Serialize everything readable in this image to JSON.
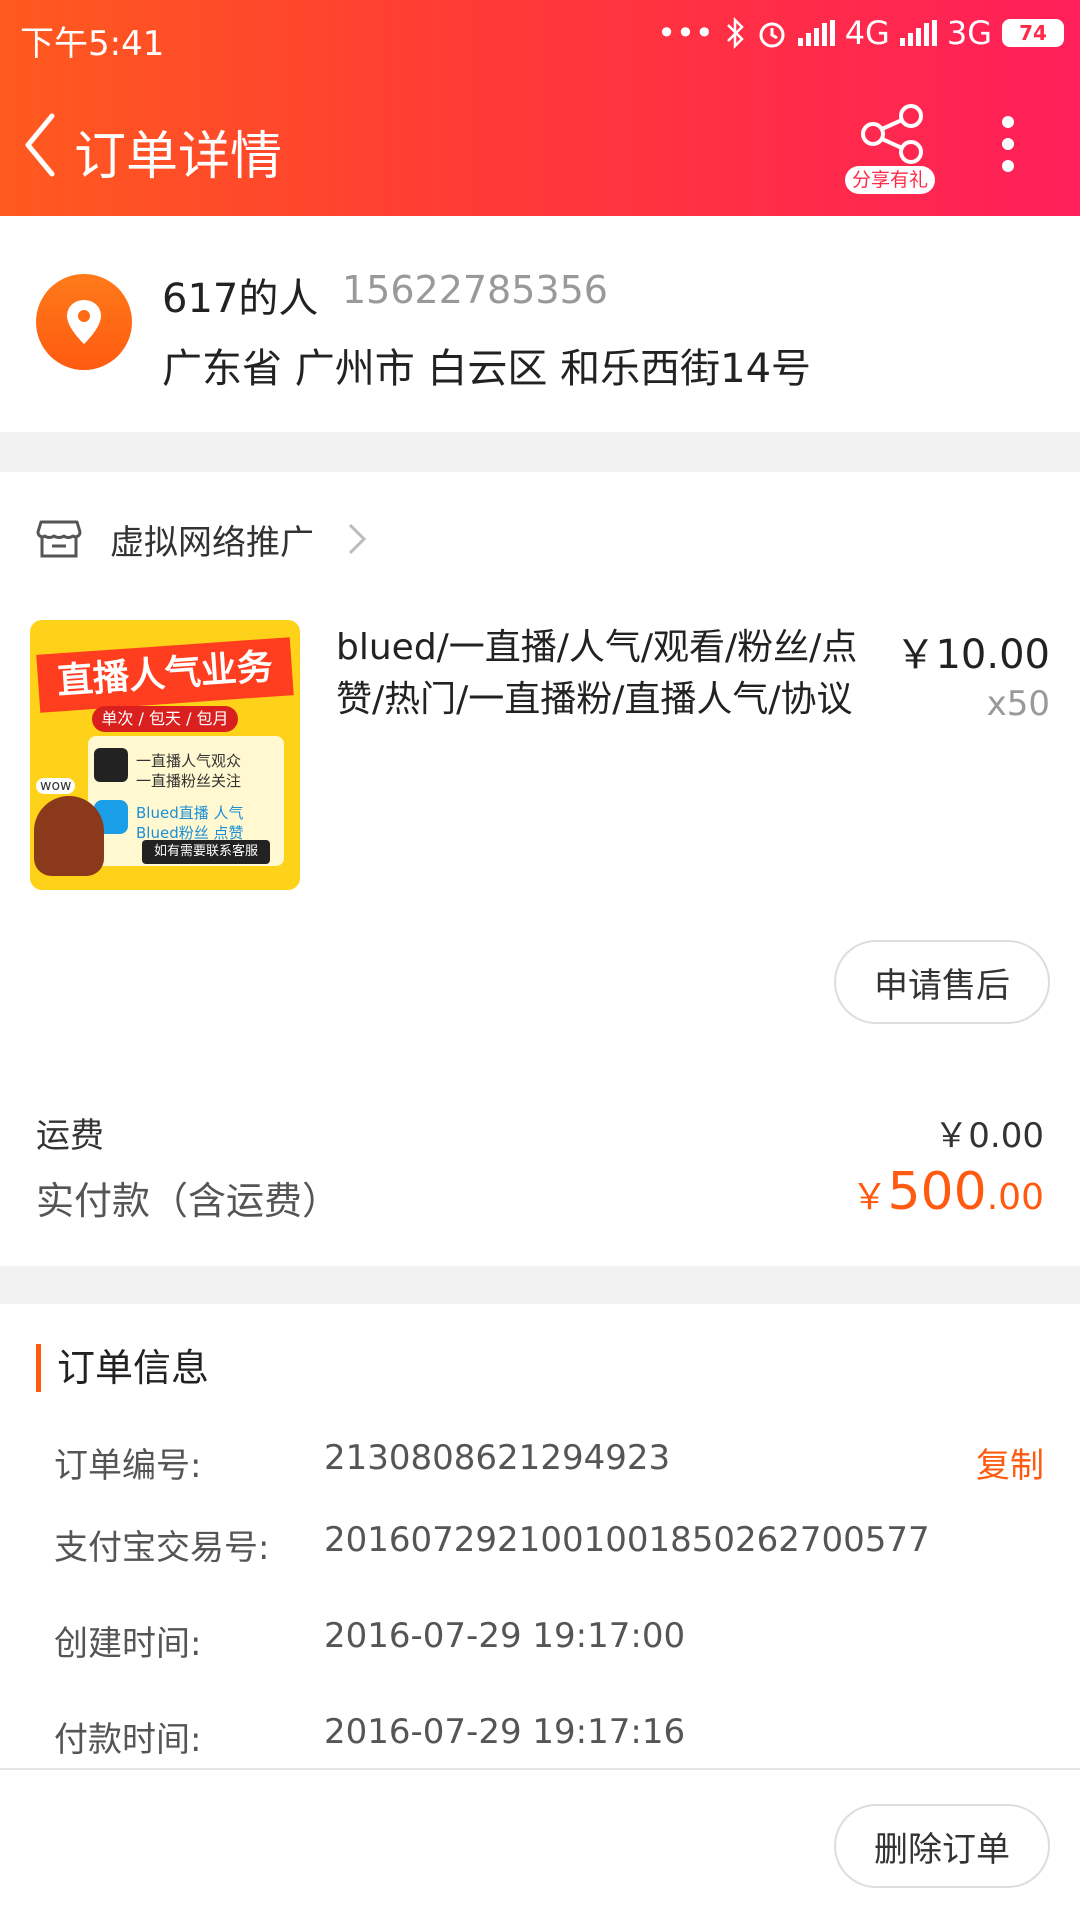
{
  "status_bar": {
    "time": "下午5:41",
    "network_4g": "4G",
    "network_3g": "3G",
    "battery": "74"
  },
  "header": {
    "title": "订单详情",
    "share_label": "分享有礼",
    "colors": {
      "gradient_start": "#ff5a1e",
      "gradient_end": "#ff1f5a"
    }
  },
  "address": {
    "name": "617的人",
    "phone": "15622785356",
    "line": "广东省 广州市 白云区 和乐西街14号",
    "icon": "location-pin-icon"
  },
  "shop": {
    "name": "虚拟网络推广",
    "icon": "store-icon"
  },
  "product": {
    "title": "blued/一直播/人气/观看/粉丝/点赞/热门/一直播粉/直播人气/协议",
    "price": "￥10.00",
    "quantity": "x50",
    "thumbnail": {
      "banner": "直播人气业务",
      "sub": "单次 / 包天 / 包月",
      "line1": "一直播人气观众",
      "line2": "一直播粉丝关注",
      "line3": "Blued直播 人气",
      "line4": "Blued粉丝 点赞",
      "footer": "如有需要联系客服",
      "badge": "wow"
    },
    "after_sale_label": "申请售后"
  },
  "fees": {
    "shipping_label": "运费",
    "shipping_value": "￥0.00",
    "paid_label": "实付款（含运费）",
    "paid_currency": "￥",
    "paid_integer": "500",
    "paid_decimal": ".00",
    "accent_color": "#ff5a10"
  },
  "order_info": {
    "title": "订单信息",
    "rows": [
      {
        "label": "订单编号:",
        "value": "2130808621294923"
      },
      {
        "label": "支付宝交易号:",
        "value": "2016072921001001850262700577"
      },
      {
        "label": "创建时间:",
        "value": "2016-07-29 19:17:00"
      },
      {
        "label": "付款时间:",
        "value": "2016-07-29 19:17:16"
      }
    ],
    "copy_label": "复制"
  },
  "bottom": {
    "delete_label": "删除订单"
  }
}
